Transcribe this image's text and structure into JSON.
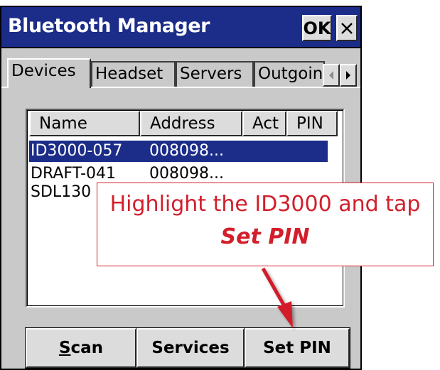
{
  "window": {
    "title": "Bluetooth Manager",
    "ok_label": "OK"
  },
  "tabs": [
    {
      "label": "Devices",
      "active": true
    },
    {
      "label": "Headset",
      "active": false
    },
    {
      "label": "Servers",
      "active": false
    },
    {
      "label": "Outgoing",
      "active": false
    }
  ],
  "list": {
    "columns": [
      "Name",
      "Address",
      "Act",
      "PIN"
    ],
    "rows": [
      {
        "name": "ID3000-057",
        "address": "008098...",
        "selected": true
      },
      {
        "name": "DRAFT-041",
        "address": "008098...",
        "selected": false
      },
      {
        "name": "SDL130",
        "address": "",
        "selected": false
      }
    ]
  },
  "buttons": {
    "scan_prefix": "S",
    "scan_rest": "can",
    "services": "Services",
    "set_pin": "Set PIN"
  },
  "callout": {
    "line1": "Highlight the ID3000 and tap",
    "line2": "Set PIN"
  },
  "colors": {
    "titlebar": "#1b2c89",
    "selection": "#1b2c89",
    "callout": "#d21f2b",
    "window_bg": "#c9c9c9"
  }
}
